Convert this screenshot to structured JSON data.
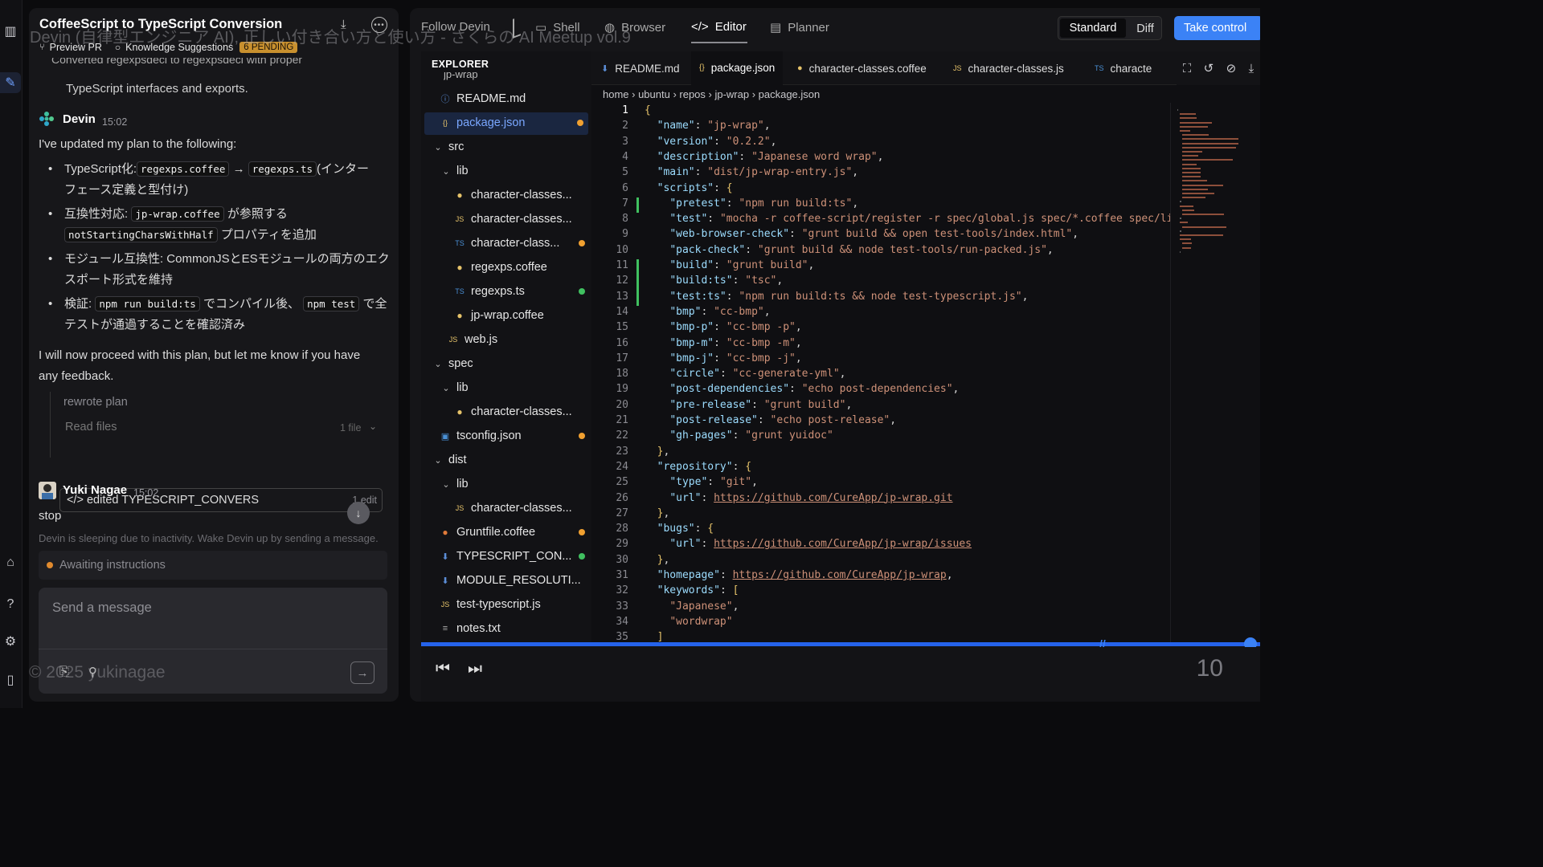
{
  "watermark": {
    "top": "Devin (自律型エンジニア AI), 正しい付き合い方と使い方 - さくらの AI Meetup vol.9",
    "bottom": "© 2025 yukinagae"
  },
  "chat": {
    "title": "CoffeeScript to TypeScript Conversion",
    "preview_pr": "Preview PR",
    "knowledge": "Knowledge Suggestions",
    "pending": "6 PENDING",
    "prev_line_a": "Converted regexpsdecl to regexpsdecl with proper",
    "prev_line_b": "TypeScript interfaces and exports.",
    "devin_name": "Devin",
    "devin_time": "15:02",
    "plan_intro": "I've updated my plan to the following:",
    "b1_a": "TypeScript化:",
    "b1_c1": "regexps.coffee",
    "b1_arrow": "→",
    "b1_c2": "regexps.ts",
    "b1_b": "(インター",
    "b1_c": "フェース定義と型付け)",
    "b2_a": "互換性対応:",
    "b2_c1": "jp-wrap.coffee",
    "b2_b": "が参照する",
    "b2_c2": "notStartingCharsWithHalf",
    "b2_c": "プロパティを追加",
    "b3_a": "モジュール互換性: CommonJSとESモジュールの両方のエク",
    "b3_b": "スポート形式を維持",
    "b4_a": "検証:",
    "b4_c1": "npm run build:ts",
    "b4_b": "でコンパイル後、",
    "b4_c2": "npm test",
    "b4_c": "で全",
    "b4_d": "テストが通過することを確認済み",
    "proceed_a": "I will now proceed with this plan, but let me know if you have",
    "proceed_b": "any feedback.",
    "act_rewrote": "rewrote plan",
    "act_read": "Read files",
    "act_read_count": "1 file",
    "act_edit": "</> edited TYPESCRIPT_CONVERS",
    "act_edit_count": "1 edit",
    "user_name": "Yuki Nagae",
    "user_time": "15:02",
    "user_msg": "stop",
    "sleep": "Devin is sleeping due to inactivity. Wake Devin up by sending a message.",
    "status": "Awaiting instructions",
    "placeholder": "Send a message"
  },
  "top_tabs": {
    "follow": "Follow Devin",
    "shell": "Shell",
    "browser": "Browser",
    "editor": "Editor",
    "planner": "Planner",
    "standard": "Standard",
    "diff": "Diff",
    "take_control": "Take control"
  },
  "explorer": {
    "title": "EXPLORER",
    "top_cut": "jp-wrap",
    "items": [
      "README.md",
      "package.json",
      "src",
      "lib",
      "character-classes...",
      "character-classes...",
      "character-class...",
      "regexps.coffee",
      "regexps.ts",
      "jp-wrap.coffee",
      "web.js",
      "spec",
      "lib",
      "character-classes...",
      "tsconfig.json",
      "dist",
      "lib",
      "character-classes...",
      "Gruntfile.coffee",
      "TYPESCRIPT_CON...",
      "MODULE_RESOLUTI...",
      "test-typescript.js",
      "notes.txt"
    ]
  },
  "file_tabs": [
    "README.md",
    "package.json",
    "character-classes.coffee",
    "character-classes.js",
    "characte"
  ],
  "breadcrumb": "home › ubuntu › repos › jp-wrap › package.json",
  "code_lines": [
    "{",
    "  \"name\": \"jp-wrap\",",
    "  \"version\": \"0.2.2\",",
    "  \"description\": \"Japanese word wrap\",",
    "  \"main\": \"dist/jp-wrap-entry.js\",",
    "  \"scripts\": {",
    "    \"pretest\": \"npm run build:ts\",",
    "    \"test\": \"mocha -r coffee-script/register -r spec/global.js spec/*.coffee spec/lil",
    "    \"web-browser-check\": \"grunt build && open test-tools/index.html\",",
    "    \"pack-check\": \"grunt build && node test-tools/run-packed.js\",",
    "    \"build\": \"grunt build\",",
    "    \"build:ts\": \"tsc\",",
    "    \"test:ts\": \"npm run build:ts && node test-typescript.js\",",
    "    \"bmp\": \"cc-bmp\",",
    "    \"bmp-p\": \"cc-bmp -p\",",
    "    \"bmp-m\": \"cc-bmp -m\",",
    "    \"bmp-j\": \"cc-bmp -j\",",
    "    \"circle\": \"cc-generate-yml\",",
    "    \"post-dependencies\": \"echo post-dependencies\",",
    "    \"pre-release\": \"grunt build\",",
    "    \"post-release\": \"echo post-release\",",
    "    \"gh-pages\": \"grunt yuidoc\"",
    "  },",
    "  \"repository\": {",
    "    \"type\": \"git\",",
    "    \"url\": \"https://github.com/CureApp/jp-wrap.git\"",
    "  },",
    "  \"bugs\": {",
    "    \"url\": \"https://github.com/CureApp/jp-wrap/issues\"",
    "  },",
    "  \"homepage\": \"https://github.com/CureApp/jp-wrap\",",
    "  \"keywords\": [",
    "    \"Japanese\",",
    "    \"wordwrap\"",
    "  ]"
  ],
  "step_number": "10",
  "colors": {
    "accent": "#3b82f6",
    "modified": "#f0a030",
    "added": "#40c060",
    "pending": "#c8902e"
  }
}
